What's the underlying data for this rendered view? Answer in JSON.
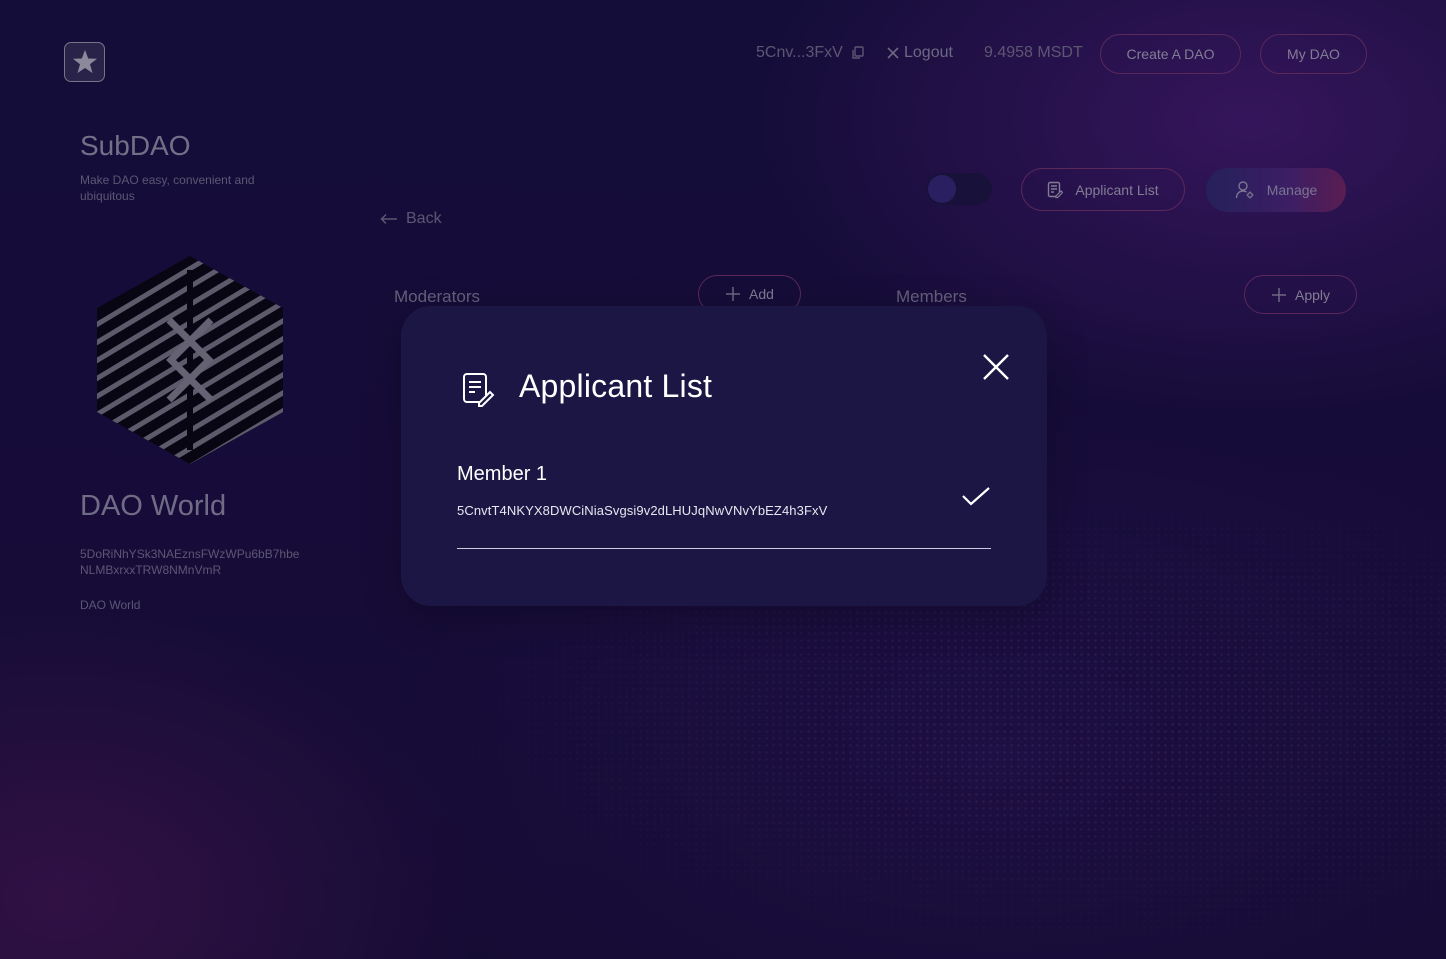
{
  "header": {
    "wallet_short": "5Cnv...3FxV",
    "logout_label": "Logout",
    "balance": "9.4958 MSDT",
    "create_dao_label": "Create A DAO",
    "my_dao_label": "My DAO"
  },
  "brand": {
    "title": "SubDAO",
    "subtitle": "Make DAO easy, convenient and ubiquitous"
  },
  "dao": {
    "name": "DAO World",
    "address": "5DoRiNhYSk3NAEznsFWzWPu6bB7hbeNLMBxrxxTRW8NMnVmR",
    "description": "DAO World"
  },
  "actions": {
    "applicant_list_label": "Applicant List",
    "manage_label": "Manage",
    "back_label": "Back"
  },
  "sections": {
    "moderators_label": "Moderators",
    "add_label": "Add",
    "members_label": "Members",
    "apply_label": "Apply"
  },
  "modal": {
    "title": "Applicant List",
    "applicants": [
      {
        "name": "Member 1",
        "address": "5CnvtT4NKYX8DWCiNiaSvgsi9v2dLHUJqNwVNvYbEZ4h3FxV"
      }
    ]
  },
  "icons": {
    "logo": "star-icon",
    "copy": "copy-icon",
    "close": "close-icon",
    "back": "arrow-left-icon",
    "plus": "plus-icon",
    "document": "document-edit-icon",
    "manage": "user-gear-icon",
    "approve": "checkmark-icon"
  },
  "colors": {
    "background": "#160d3a",
    "modal": "#1c1644",
    "button_border": "#8a3c7c",
    "manage_gradient_start": "#35307c",
    "manage_gradient_end": "#8a2a6e"
  }
}
